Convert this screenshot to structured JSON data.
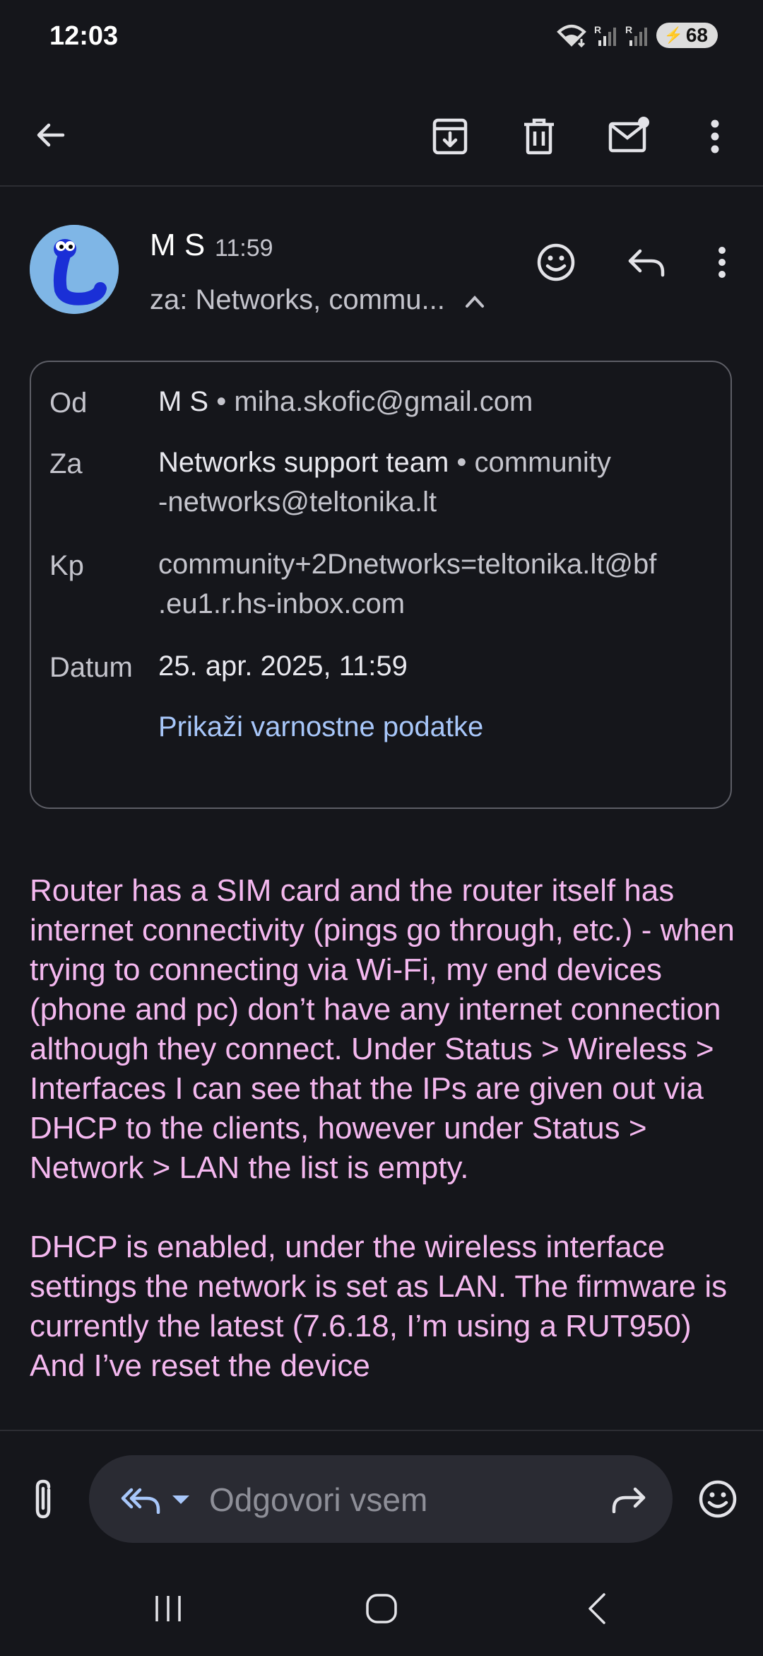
{
  "status_bar": {
    "time": "12:03",
    "battery": "68",
    "icons": [
      "wifi-icon",
      "signal-r-icon",
      "signal-r-icon",
      "battery-icon"
    ]
  },
  "toolbar": {
    "back_icon": "arrow-left-icon",
    "archive_icon": "archive-icon",
    "delete_icon": "trash-icon",
    "mark_unread_icon": "mail-unread-icon",
    "more_icon": "more-vert-icon"
  },
  "message": {
    "sender_name": "M S",
    "time": "11:59",
    "recipients_summary": "za: Networks, commu...",
    "details": {
      "from_label": "Od",
      "from_name": "M S",
      "from_email": "miha.skofic@gmail.com",
      "to_label": "Za",
      "to_name": "Networks support team",
      "to_email_line1": "community",
      "to_email_line2": "-networks@teltonika.lt",
      "cc_label": "Kp",
      "cc_line1": "community+2Dnetworks=teltonika.lt@bf",
      "cc_line2": ".eu1.r.hs-inbox.com",
      "date_label": "Datum",
      "date_value": "25. apr. 2025, 11:59",
      "security_link": "Prikaži varnostne podatke"
    },
    "body": {
      "paragraph1": "Router has a SIM card and the router itself has internet connectivity (pings go through, etc.) - when trying to connecting via Wi-Fi, my end devices (phone and pc) don’t have any internet connection although they connect. Under Status > Wireless > Interfaces I can see that the IPs are given out via DHCP to the clients, however under Status > Network > LAN the list is empty.",
      "paragraph2": "DHCP is enabled, under the wireless interface settings the network is set as LAN. The firmware is currently the latest (7.6.18, I’m using a RUT950) And I’ve reset the device"
    }
  },
  "compose": {
    "reply_placeholder": "Odgovori vsem"
  },
  "colors": {
    "background": "#15161b",
    "body_text": "#f4b8ef",
    "link": "#a8c7fa",
    "pill": "#2a2b33"
  }
}
